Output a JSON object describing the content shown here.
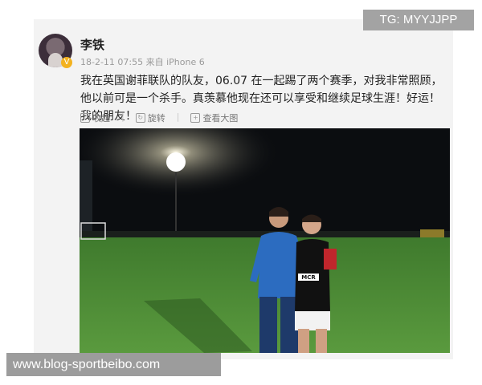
{
  "post": {
    "username": "李铁",
    "meta": "18-2-11 07:55 来自 iPhone 6",
    "text": "我在英国谢菲联队的队友，06.07 在一起踢了两个赛季，对我非常照顾，他以前可是一个杀手。真羡慕他现在还可以享受和继续足球生涯！好运！我的朋友！"
  },
  "actions": {
    "collect": "收起",
    "rotate": "旋转",
    "view_large": "查看大图"
  },
  "photo": {
    "jersey_text": "MCR"
  },
  "overlays": {
    "tg": "TG: MYYJJPP",
    "site": "www.blog-sportbeibo.com"
  },
  "colors": {
    "pitch": "#4d8a36",
    "sky": "#0b0d10",
    "tracksuit": "#2c6cc0",
    "jersey": "#111111"
  }
}
